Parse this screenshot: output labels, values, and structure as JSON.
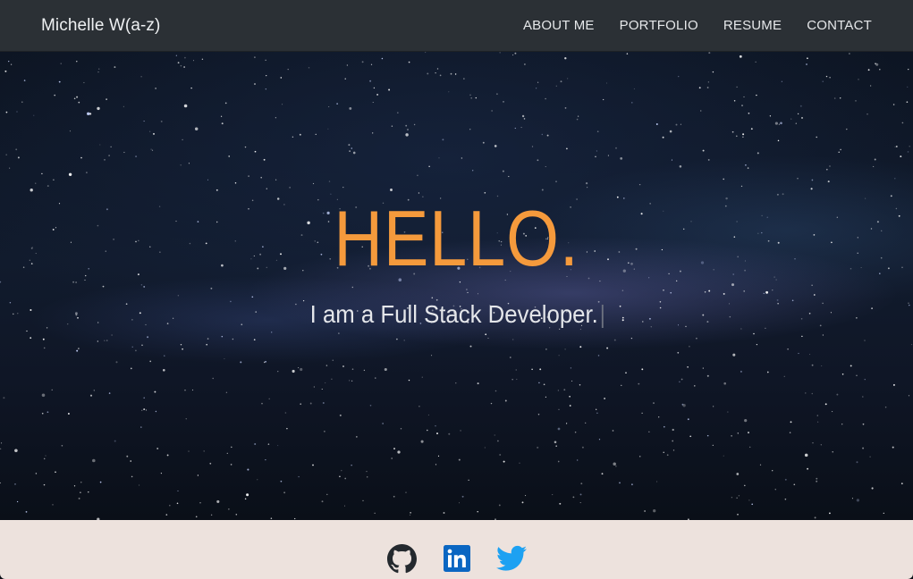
{
  "navbar": {
    "brand": "Michelle W(a-z)",
    "links": [
      "ABOUT ME",
      "PORTFOLIO",
      "RESUME",
      "CONTACT"
    ]
  },
  "hero": {
    "title": "HELLO.",
    "subtitle": "I am a Full Stack Developer."
  },
  "footer": {
    "social_icons": [
      "github-icon",
      "linkedin-icon",
      "twitter-icon"
    ]
  },
  "colors": {
    "navbar_bg": "#2b3035",
    "title_accent": "#f59a3c",
    "footer_bg": "#ede2dd",
    "linkedin_blue": "#0a66c2",
    "twitter_blue": "#1da1f2",
    "github_dark": "#24292e"
  }
}
